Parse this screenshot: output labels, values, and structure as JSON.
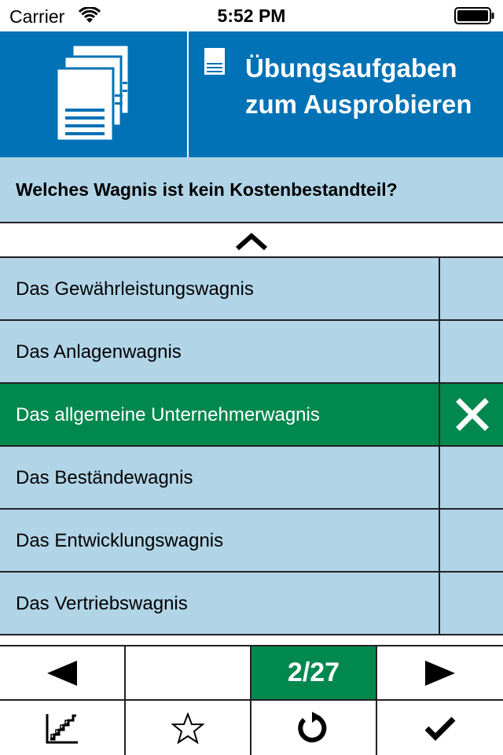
{
  "status_bar": {
    "carrier": "Carrier",
    "time": "5:52 PM"
  },
  "header": {
    "title_line1": "Übungsaufgaben",
    "title_line2": "zum Ausprobieren",
    "icons": [
      "documents-icon",
      "document-icon"
    ]
  },
  "question": {
    "text": "Welches Wagnis ist kein Kostenbestandteil?"
  },
  "answers": [
    {
      "label": "Das Gewährleistungswagnis",
      "selected": false
    },
    {
      "label": "Das Anlagenwagnis",
      "selected": false
    },
    {
      "label": "Das allgemeine Unternehmerwagnis",
      "selected": true,
      "mark": "x-icon"
    },
    {
      "label": "Das Beständewagnis",
      "selected": false
    },
    {
      "label": "Das Entwicklungswagnis",
      "selected": false
    },
    {
      "label": "Das Vertriebswagnis",
      "selected": false
    }
  ],
  "toolbar": {
    "counter": "2/27",
    "icons": [
      "arrow-left-icon",
      "arrow-right-icon",
      "chart-icon",
      "star-icon",
      "refresh-icon",
      "checkmark-icon"
    ]
  },
  "colors": {
    "header_blue": "#0272b6",
    "light_blue": "#b1d4e7",
    "green": "#00884f"
  }
}
